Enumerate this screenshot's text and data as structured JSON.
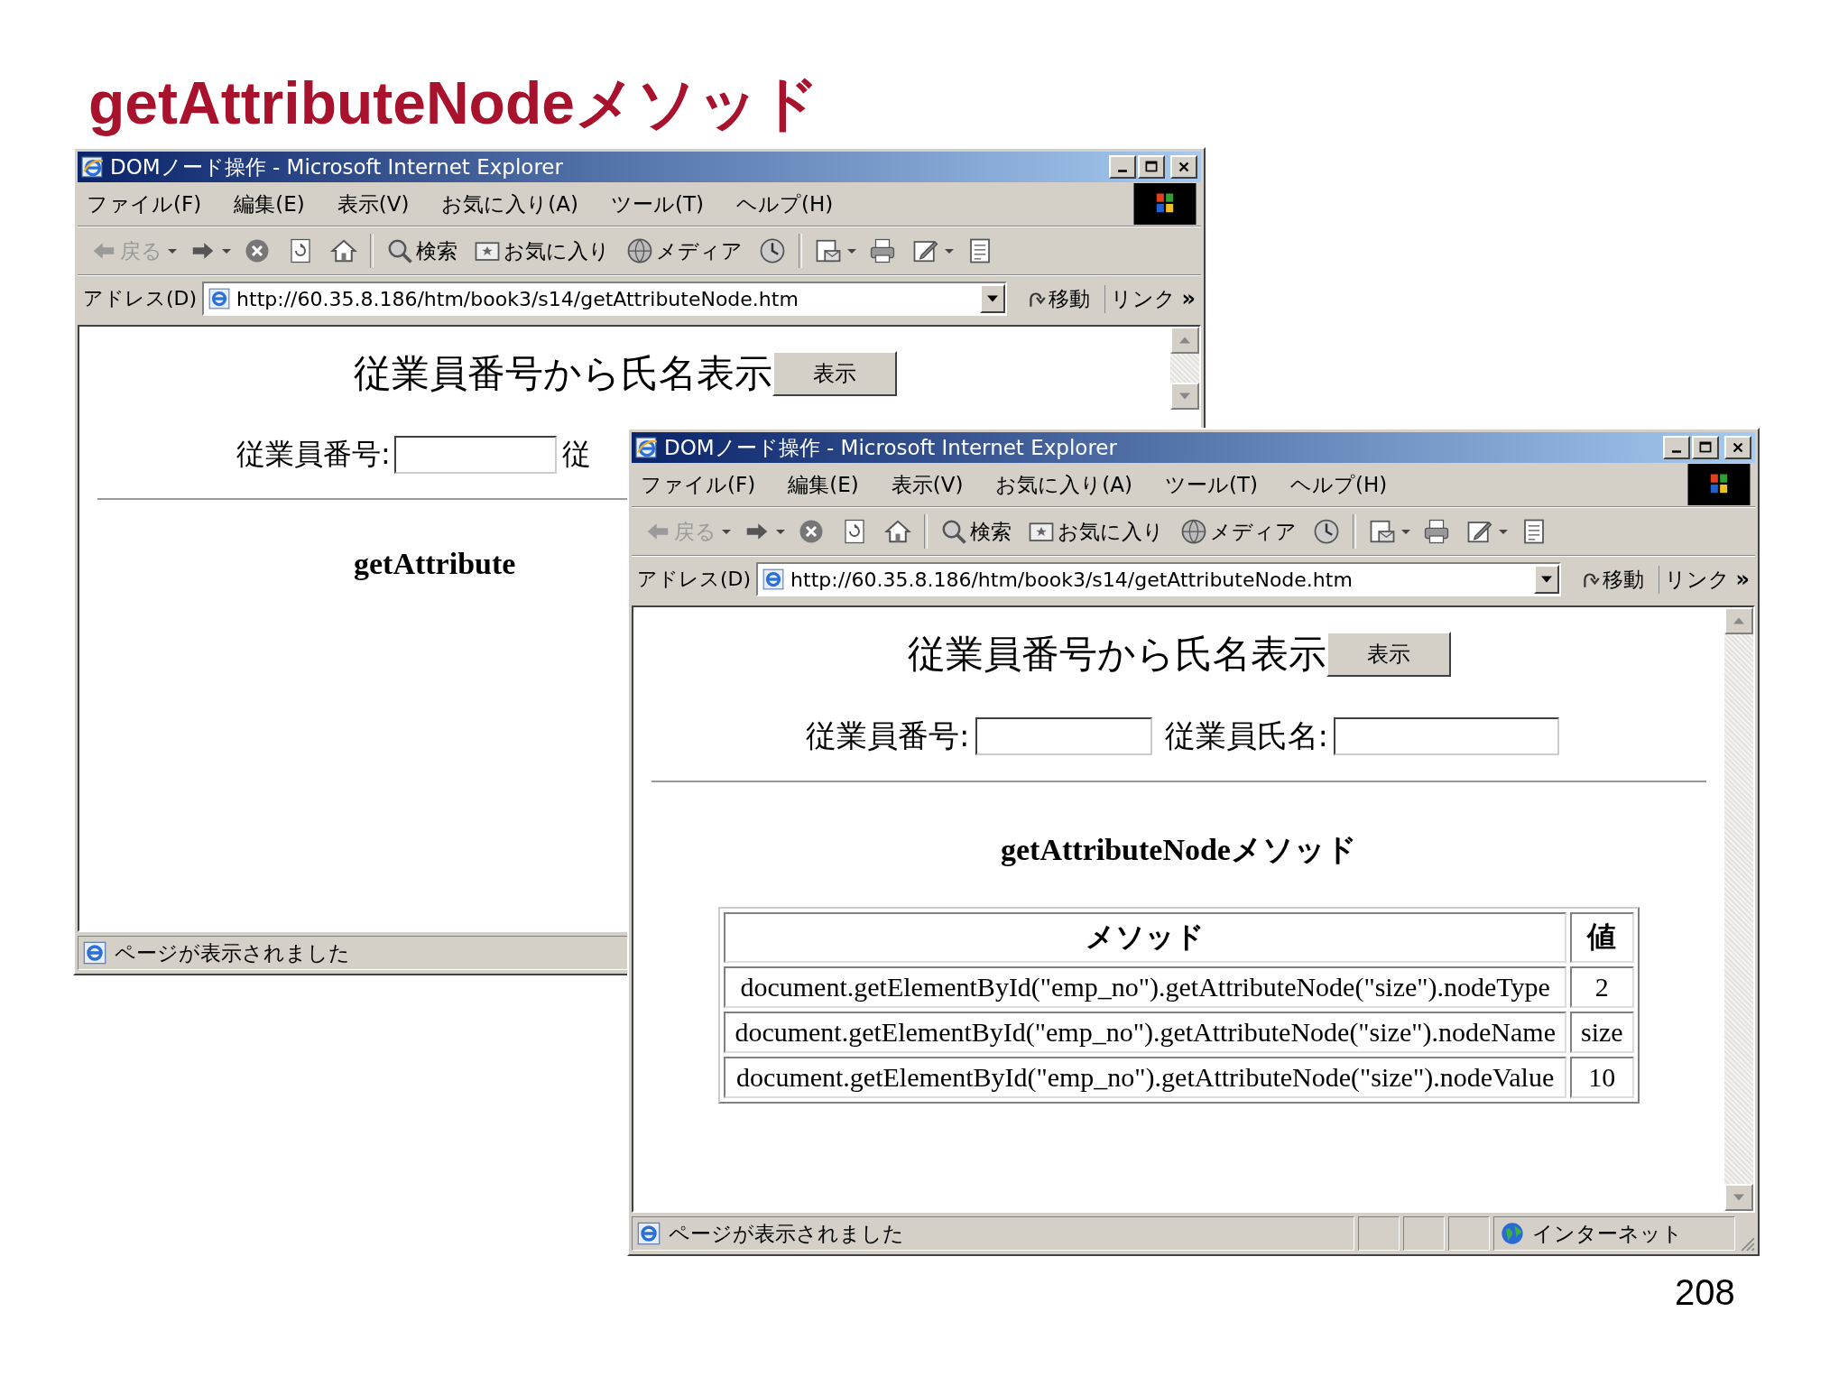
{
  "slide_title": "getAttributeNodeメソッド",
  "windows": [
    {
      "title": "DOMノード操作 - Microsoft Internet Explorer",
      "menu": [
        "ファイル(F)",
        "編集(E)",
        "表示(V)",
        "お気に入り(A)",
        "ツール(T)",
        "ヘルプ(H)"
      ],
      "toolbar": [
        {
          "kind": "back",
          "label": "戻る"
        },
        {
          "kind": "dropdown"
        },
        {
          "kind": "forward"
        },
        {
          "kind": "dropdown"
        },
        {
          "kind": "stop"
        },
        {
          "kind": "refresh"
        },
        {
          "kind": "home"
        },
        {
          "kind": "separator"
        },
        {
          "kind": "search",
          "label": "検索"
        },
        {
          "kind": "favorites",
          "label": "お気に入り"
        },
        {
          "kind": "media",
          "label": "メディア"
        },
        {
          "kind": "history"
        },
        {
          "kind": "separator"
        },
        {
          "kind": "mail"
        },
        {
          "kind": "dropdown"
        },
        {
          "kind": "print"
        },
        {
          "kind": "edit"
        },
        {
          "kind": "dropdown"
        },
        {
          "kind": "discuss"
        }
      ],
      "address_label": "アドレス(D)",
      "url": "http://60.35.8.186/htm/book3/s14/getAttributeNode.htm",
      "go": "移動",
      "links": "リンク",
      "links_more": "»",
      "page": {
        "heading": "従業員番号から氏名表示",
        "button": "表示",
        "form": [
          {
            "kind": "label",
            "text": "従業員番号:"
          },
          {
            "kind": "input"
          },
          {
            "kind": "label",
            "text": "従"
          }
        ],
        "subtitle": "getAttribute"
      },
      "status": "ページが表示されました"
    },
    {
      "title": "DOMノード操作 - Microsoft Internet Explorer",
      "menu": [
        "ファイル(F)",
        "編集(E)",
        "表示(V)",
        "お気に入り(A)",
        "ツール(T)",
        "ヘルプ(H)"
      ],
      "toolbar": [
        {
          "kind": "back",
          "label": "戻る"
        },
        {
          "kind": "dropdown"
        },
        {
          "kind": "forward"
        },
        {
          "kind": "dropdown"
        },
        {
          "kind": "stop"
        },
        {
          "kind": "refresh"
        },
        {
          "kind": "home"
        },
        {
          "kind": "separator"
        },
        {
          "kind": "search",
          "label": "検索"
        },
        {
          "kind": "favorites",
          "label": "お気に入り"
        },
        {
          "kind": "media",
          "label": "メディア"
        },
        {
          "kind": "history"
        },
        {
          "kind": "separator"
        },
        {
          "kind": "mail"
        },
        {
          "kind": "dropdown"
        },
        {
          "kind": "print"
        },
        {
          "kind": "edit"
        },
        {
          "kind": "dropdown"
        },
        {
          "kind": "discuss"
        }
      ],
      "address_label": "アドレス(D)",
      "url": "http://60.35.8.186/htm/book3/s14/getAttributeNode.htm",
      "go": "移動",
      "links": "リンク",
      "links_more": "»",
      "page": {
        "heading": "従業員番号から氏名表示",
        "button": "表示",
        "form": [
          {
            "kind": "label",
            "text": "従業員番号:"
          },
          {
            "kind": "input"
          },
          {
            "kind": "label",
            "text": "従業員氏名:"
          },
          {
            "kind": "input"
          }
        ],
        "subtitle": "getAttributeNodeメソッド",
        "table": {
          "columns": [
            "メソッド",
            "値"
          ],
          "rows": [
            [
              "document.getElementById(\"emp_no\").getAttributeNode(\"size\").nodeType",
              "2"
            ],
            [
              "document.getElementById(\"emp_no\").getAttributeNode(\"size\").nodeName",
              "size"
            ],
            [
              "document.getElementById(\"emp_no\").getAttributeNode(\"size\").nodeValue",
              "10"
            ]
          ]
        }
      },
      "status": "ページが表示されました",
      "zone": "インターネット"
    }
  ],
  "page_number": "208"
}
